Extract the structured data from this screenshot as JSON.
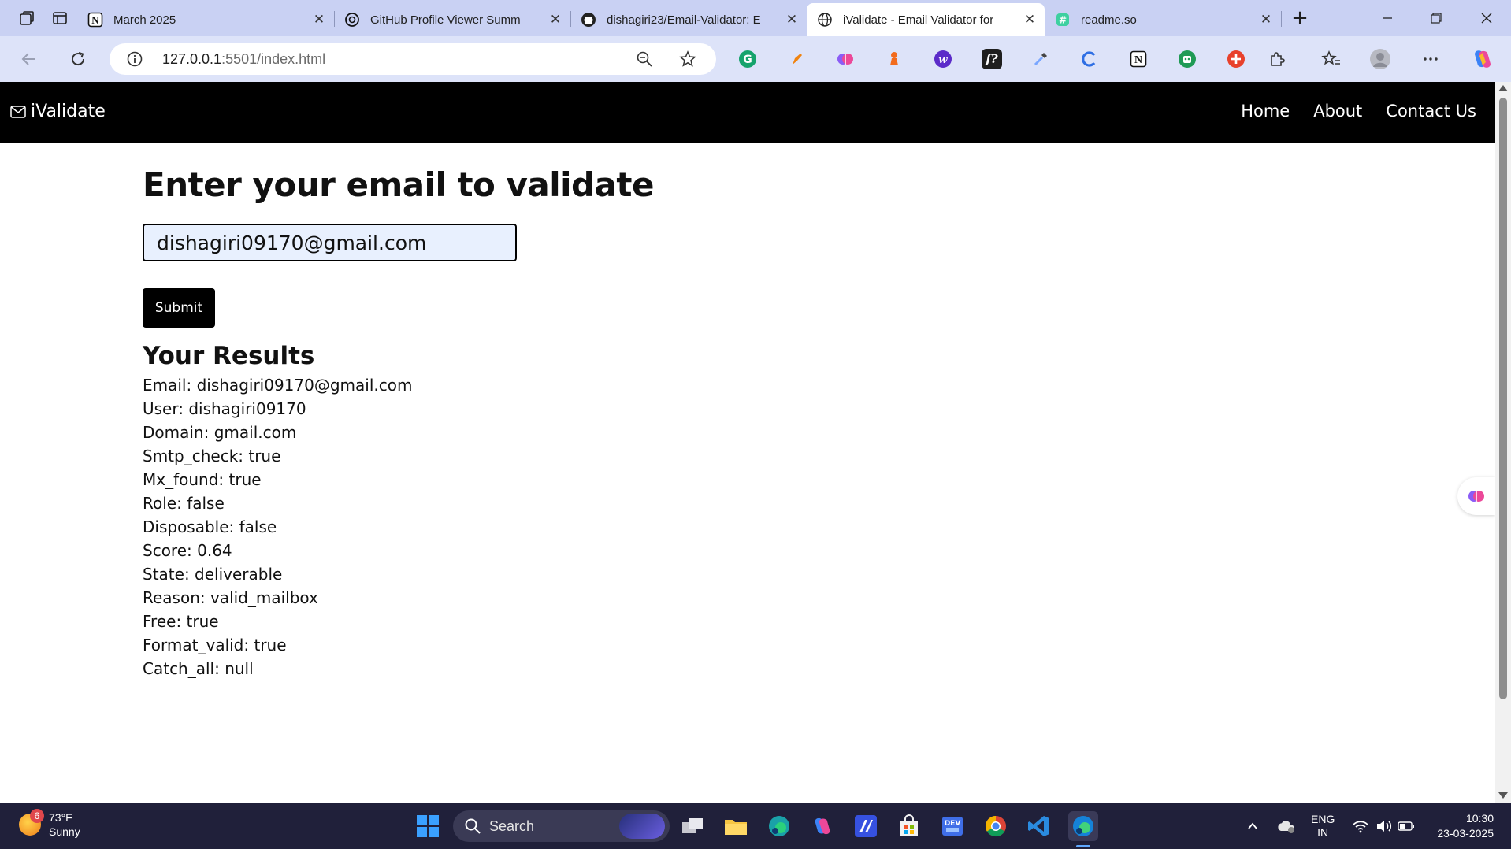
{
  "browser": {
    "tabs": [
      {
        "title": "March 2025",
        "icon": "notion-icon",
        "active": false
      },
      {
        "title": "GitHub Profile Viewer Summ",
        "icon": "chatgpt-icon",
        "active": false
      },
      {
        "title": "dishagiri23/Email-Validator: E",
        "icon": "github-icon",
        "active": false
      },
      {
        "title": "iValidate - Email Validator for",
        "icon": "globe-icon",
        "active": true
      },
      {
        "title": "readme.so",
        "icon": "readme-icon",
        "active": false
      }
    ],
    "url_host": "127.0.0.1",
    "url_rest": ":5501/index.html"
  },
  "site": {
    "brand": "iValidate",
    "nav": {
      "home": "Home",
      "about": "About",
      "contact": "Contact Us"
    }
  },
  "form": {
    "heading": "Enter your email to validate",
    "email_value": "dishagiri09170@gmail.com",
    "submit_label": "Submit"
  },
  "results": {
    "heading": "Your Results",
    "lines": [
      "Email: dishagiri09170@gmail.com",
      "User: dishagiri09170",
      "Domain: gmail.com",
      "Smtp_check: true",
      "Mx_found: true",
      "Role: false",
      "Disposable: false",
      "Score: 0.64",
      "State: deliverable",
      "Reason: valid_mailbox",
      "Free: true",
      "Format_valid: true",
      "Catch_all: null"
    ]
  },
  "taskbar": {
    "weather_temp": "73°F",
    "weather_cond": "Sunny",
    "weather_badge": "6",
    "search_label": "Search",
    "lang_top": "ENG",
    "lang_bottom": "IN",
    "time": "10:30",
    "date": "23-03-2025"
  },
  "colors": {
    "nav_bg": "#000000",
    "input_bg": "#e8f0fe",
    "tabstrip_bg": "#c9d1f3",
    "toolbar_bg": "#dde3f9",
    "taskbar_bg": "#20203a"
  }
}
